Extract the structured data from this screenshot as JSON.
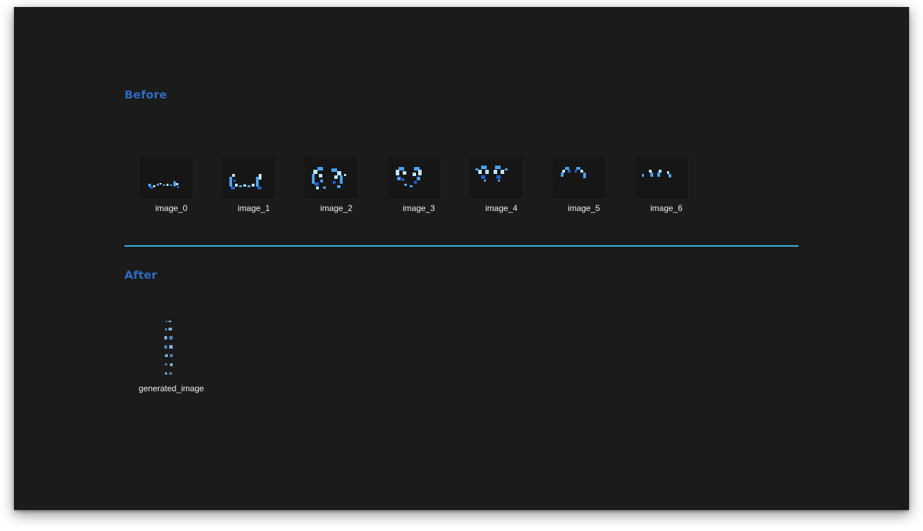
{
  "sections": {
    "before_title": "Before",
    "after_title": "After"
  },
  "before_images": [
    {
      "label": "image_0"
    },
    {
      "label": "image_1"
    },
    {
      "label": "image_2"
    },
    {
      "label": "image_3"
    },
    {
      "label": "image_4"
    },
    {
      "label": "image_5"
    },
    {
      "label": "image_6"
    }
  ],
  "after_image": {
    "label": "generated_image"
  },
  "colors": {
    "background": "#1b1b1b",
    "heading": "#2f6bc0",
    "divider": "#38b6e6",
    "sprite_light": "#bfe6ff",
    "sprite_mid": "#4aa3f0",
    "sprite_dark": "#1f5fd0"
  }
}
